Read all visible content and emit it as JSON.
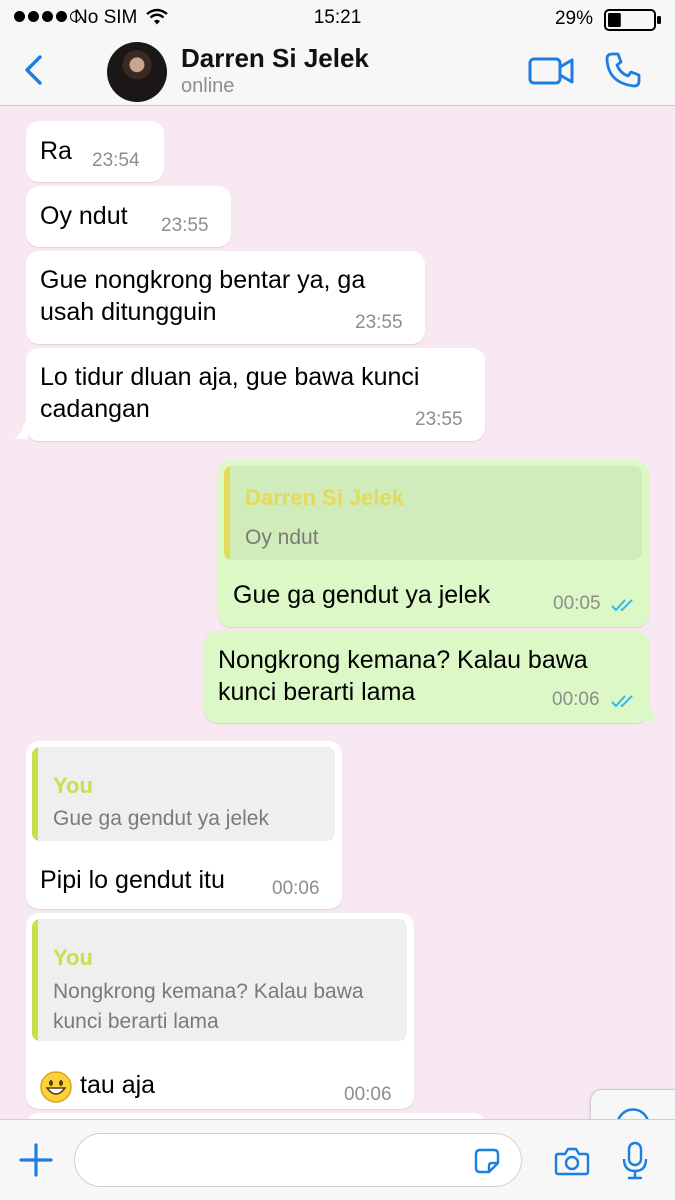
{
  "status_bar": {
    "carrier": "No SIM",
    "time": "15:21",
    "battery": "29%",
    "battery_level": 0.29
  },
  "header": {
    "contact_name": "Darren Si Jelek",
    "contact_status": "online"
  },
  "messages": [
    {
      "direction": "in",
      "text_lines": [
        "Ra"
      ],
      "time": "23:54"
    },
    {
      "direction": "in",
      "text_lines": [
        "Oy ndut"
      ],
      "time": "23:55"
    },
    {
      "direction": "in",
      "text_lines": [
        "Gue nongkrong bentar ya, ga",
        "usah ditungguin"
      ],
      "time": "23:55"
    },
    {
      "direction": "in",
      "text_lines": [
        "Lo tidur dluan aja, gue bawa kunci",
        "cadangan"
      ],
      "time": "23:55"
    },
    {
      "direction": "out",
      "quote_author": "Darren Si Jelek",
      "quote_text": [
        "Oy ndut"
      ],
      "text_lines": [
        "Gue ga gendut ya jelek"
      ],
      "time": "00:05",
      "status": "read"
    },
    {
      "direction": "out",
      "text_lines": [
        "Nongkrong kemana? Kalau bawa",
        "kunci berarti lama"
      ],
      "time": "00:06",
      "status": "read"
    },
    {
      "direction": "in",
      "quote_author": "You",
      "quote_text": [
        "Gue ga gendut ya jelek"
      ],
      "text_lines": [
        "Pipi lo gendut itu"
      ],
      "time": "00:06"
    },
    {
      "direction": "in",
      "quote_author": "You",
      "quote_text": [
        "Nongkrong kemana? Kalau bawa",
        "kunci berarti lama"
      ],
      "emoji": "grinning-face",
      "text_lines": [
        "tau aja"
      ],
      "time": "00:06"
    }
  ],
  "input": {
    "placeholder": ""
  },
  "icons": {
    "back": "chevron-left-icon",
    "video": "video-call-icon",
    "call": "phone-icon",
    "scroll": "scroll-down-icon",
    "plus": "plus-icon",
    "sticker": "sticker-icon",
    "camera": "camera-icon",
    "mic": "microphone-icon"
  },
  "colors": {
    "accent": "#1c7fe0",
    "outgoing_bubble": "#dcf8c6",
    "incoming_bubble": "#ffffff",
    "chat_background": "#f8e8f1",
    "quote_author_contact": "#e5d95a",
    "quote_author_you": "#c8e04a",
    "read_ticks": "#34b7f1"
  }
}
